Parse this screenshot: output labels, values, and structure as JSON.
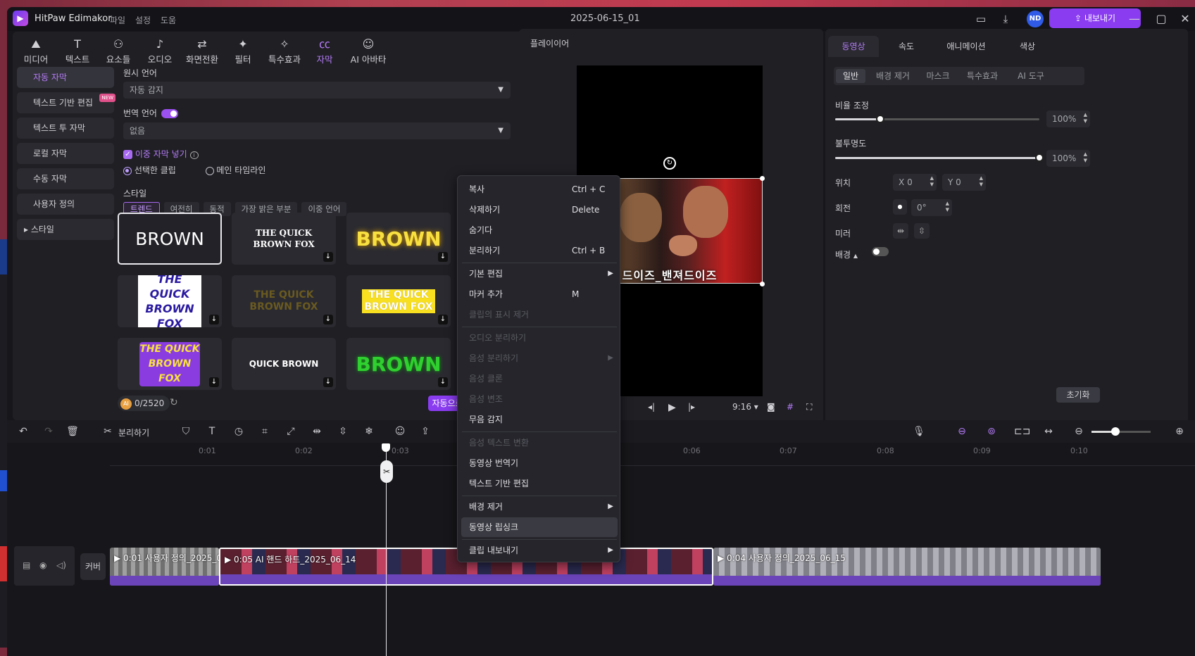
{
  "titlebar": {
    "app_name": "HitPaw Edimakor",
    "menus": [
      "파일",
      "설정",
      "도움"
    ],
    "doc_title": "2025-06-15_01",
    "avatar": "ND",
    "export_label": "내보내기"
  },
  "tool_tabs": [
    {
      "label": "미디어",
      "icon": "media-icon"
    },
    {
      "label": "텍스트",
      "icon": "text-icon"
    },
    {
      "label": "요소들",
      "icon": "elements-icon"
    },
    {
      "label": "오디오",
      "icon": "audio-icon"
    },
    {
      "label": "화면전환",
      "icon": "transition-icon"
    },
    {
      "label": "필터",
      "icon": "filter-icon"
    },
    {
      "label": "특수효과",
      "icon": "effects-icon"
    },
    {
      "label": "자막",
      "icon": "subtitle-icon",
      "active": true
    },
    {
      "label": "AI 아바타",
      "icon": "avatar-icon"
    }
  ],
  "sidebar": {
    "items": [
      "자동 자막",
      "텍스트 기반 편집",
      "텍스트 투 자막",
      "로컬 자막",
      "수동 자막",
      "사용자 정의",
      "스타일"
    ],
    "new_badge": "NEW"
  },
  "subtitle": {
    "source_lang_label": "원시 언어",
    "source_lang_value": "자동 감지",
    "translate_label": "번역 언어",
    "translate_value": "없음",
    "bilingual_label": "이중 자막 넣기",
    "radio_selected": "선택한 클립",
    "radio_main": "메인 타임라인",
    "style_label": "스타일",
    "style_chips": [
      "트렌드",
      "여전히",
      "동적",
      "가장 밝은 부분",
      "이중 언어"
    ],
    "tiles": [
      "BROWN",
      "THE QUICK BROWN FOX",
      "BROWN",
      "THE QUICK BROWN FOX",
      "THE QUICK BROWN FOX",
      "THE QUICK BROWN FOX",
      "THE QUICK BROWN FOX",
      "QUICK BROWN",
      "BROWN"
    ],
    "credits": "0/2520",
    "ai_badge": "AI",
    "auto_button": "자동으로 생성"
  },
  "player": {
    "title": "플레이이어",
    "ratio": "9:16",
    "caption_overlay": "드이즈_밴져드이즈"
  },
  "right_panel": {
    "tabs": [
      "동영상",
      "속도",
      "애니메이션",
      "색상"
    ],
    "subtabs": [
      "일반",
      "배경 제거",
      "마스크",
      "특수효과",
      "AI 도구"
    ],
    "scale_label": "비율 조정",
    "scale_value": "100%",
    "scale_level": 1.0,
    "opacity_label": "불투명도",
    "opacity_value": "100%",
    "opacity_level": 1.0,
    "position_label": "위치",
    "pos_x_label": "X",
    "pos_x": "0",
    "pos_y_label": "Y",
    "pos_y": "0",
    "rotate_label": "회전",
    "rotate_value": "0°",
    "mirror_label": "미러",
    "bg_label": "배경",
    "reset_label": "초기화"
  },
  "timeline": {
    "split_label": "분리하기",
    "ticks": [
      "0:01",
      "0:02",
      "0:03",
      "0:06",
      "0:07",
      "0:08",
      "0:09",
      "0:10"
    ],
    "cover_label": "커버",
    "clips": [
      {
        "label": "0:01 사용자 정의_2025_0"
      },
      {
        "label": "0:05 AI 핸드 하트_2025_06_14"
      },
      {
        "label": "0:04 사용자 정의_2025_06_15"
      }
    ]
  },
  "context_menu": {
    "items": [
      {
        "label": "복사",
        "shortcut": "Ctrl + C",
        "enabled": true
      },
      {
        "label": "삭제하기",
        "shortcut": "Delete",
        "enabled": true
      },
      {
        "label": "숨기다",
        "shortcut": "",
        "enabled": true
      },
      {
        "label": "분리하기",
        "shortcut": "Ctrl + B",
        "enabled": true
      },
      {
        "label": "기본 편집",
        "shortcut": "",
        "enabled": true,
        "submenu": true
      },
      {
        "label": "마커 추가",
        "shortcut": "M",
        "enabled": true
      },
      {
        "label": "클립의 표시 제거",
        "shortcut": "",
        "enabled": false
      },
      {
        "label": "오디오 분리하기",
        "shortcut": "",
        "enabled": false
      },
      {
        "label": "음성 분리하기",
        "shortcut": "",
        "enabled": false,
        "submenu": true
      },
      {
        "label": "음성 클론",
        "shortcut": "",
        "enabled": false
      },
      {
        "label": "음성 변조",
        "shortcut": "",
        "enabled": false
      },
      {
        "label": "무음 감지",
        "shortcut": "",
        "enabled": true
      },
      {
        "label": "음성 텍스트 변환",
        "shortcut": "",
        "enabled": false
      },
      {
        "label": "동영상 번역기",
        "shortcut": "",
        "enabled": true
      },
      {
        "label": "텍스트 기반 편집",
        "shortcut": "",
        "enabled": true
      },
      {
        "label": "배경 제거",
        "shortcut": "",
        "enabled": true,
        "submenu": true
      },
      {
        "label": "동영상 립싱크",
        "shortcut": "",
        "enabled": true,
        "hover": true
      },
      {
        "label": "클립 내보내기",
        "shortcut": "",
        "enabled": true,
        "submenu": true
      }
    ]
  },
  "colors": {
    "accent": "#8a3cf0",
    "accent_text": "#b57cf7",
    "panel": "#1f1f24",
    "bg": "#17171b"
  }
}
